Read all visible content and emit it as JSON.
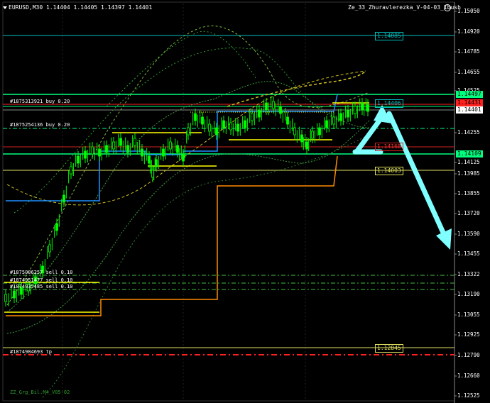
{
  "header": {
    "symbol_line": "EURUSD,M30  1.14404 1.14405 1.14397 1.14401",
    "indicator_name": "Ze_33_Zhuravlerezka_V-04-03_Ibush"
  },
  "price_axis": {
    "labels": [
      "1.15050",
      "1.14920",
      "1.14785",
      "1.14655",
      "1.14525",
      "1.14255",
      "1.14125",
      "1.13985",
      "1.13855",
      "1.13720",
      "1.13590",
      "1.13455",
      "1.13322",
      "1.13190",
      "1.13055",
      "1.12925",
      "1.12790",
      "1.12660",
      "1.12525"
    ]
  },
  "price_boxes": {
    "p_14885": "1.14885",
    "p_14497": "1.14497",
    "p_14431": "1.14431",
    "p_14401": "1.14401",
    "p_14406": "1.14406",
    "p_14168": "1.14168",
    "p_14109": "1.14109",
    "p_14003": "1.14003",
    "p_12845": "1.12845"
  },
  "orders": {
    "buy1": "#1875313921 buy 0.20",
    "buy2": "#1875254136 buy 0.20",
    "sell1": "#1875006257 sell 0.10",
    "sell2": "#1874951477 sell 0.10",
    "sell3": "#1874935485 sell 0.10",
    "tp": "#1874984693 tp"
  },
  "footer": {
    "label": "ZZ_Grg_Bil.M4_V05-02"
  },
  "colors": {
    "background": "#000000",
    "candle": "#00ff00",
    "cyan": "#00bfbf",
    "yellow": "#ffff00",
    "orange": "#ff8c00",
    "red": "#ff2020",
    "blue": "#1e90ff",
    "arrow": "#7fffff"
  },
  "icons": {
    "dropdown": "triangle-down-icon",
    "smiley": "smiley-icon"
  }
}
